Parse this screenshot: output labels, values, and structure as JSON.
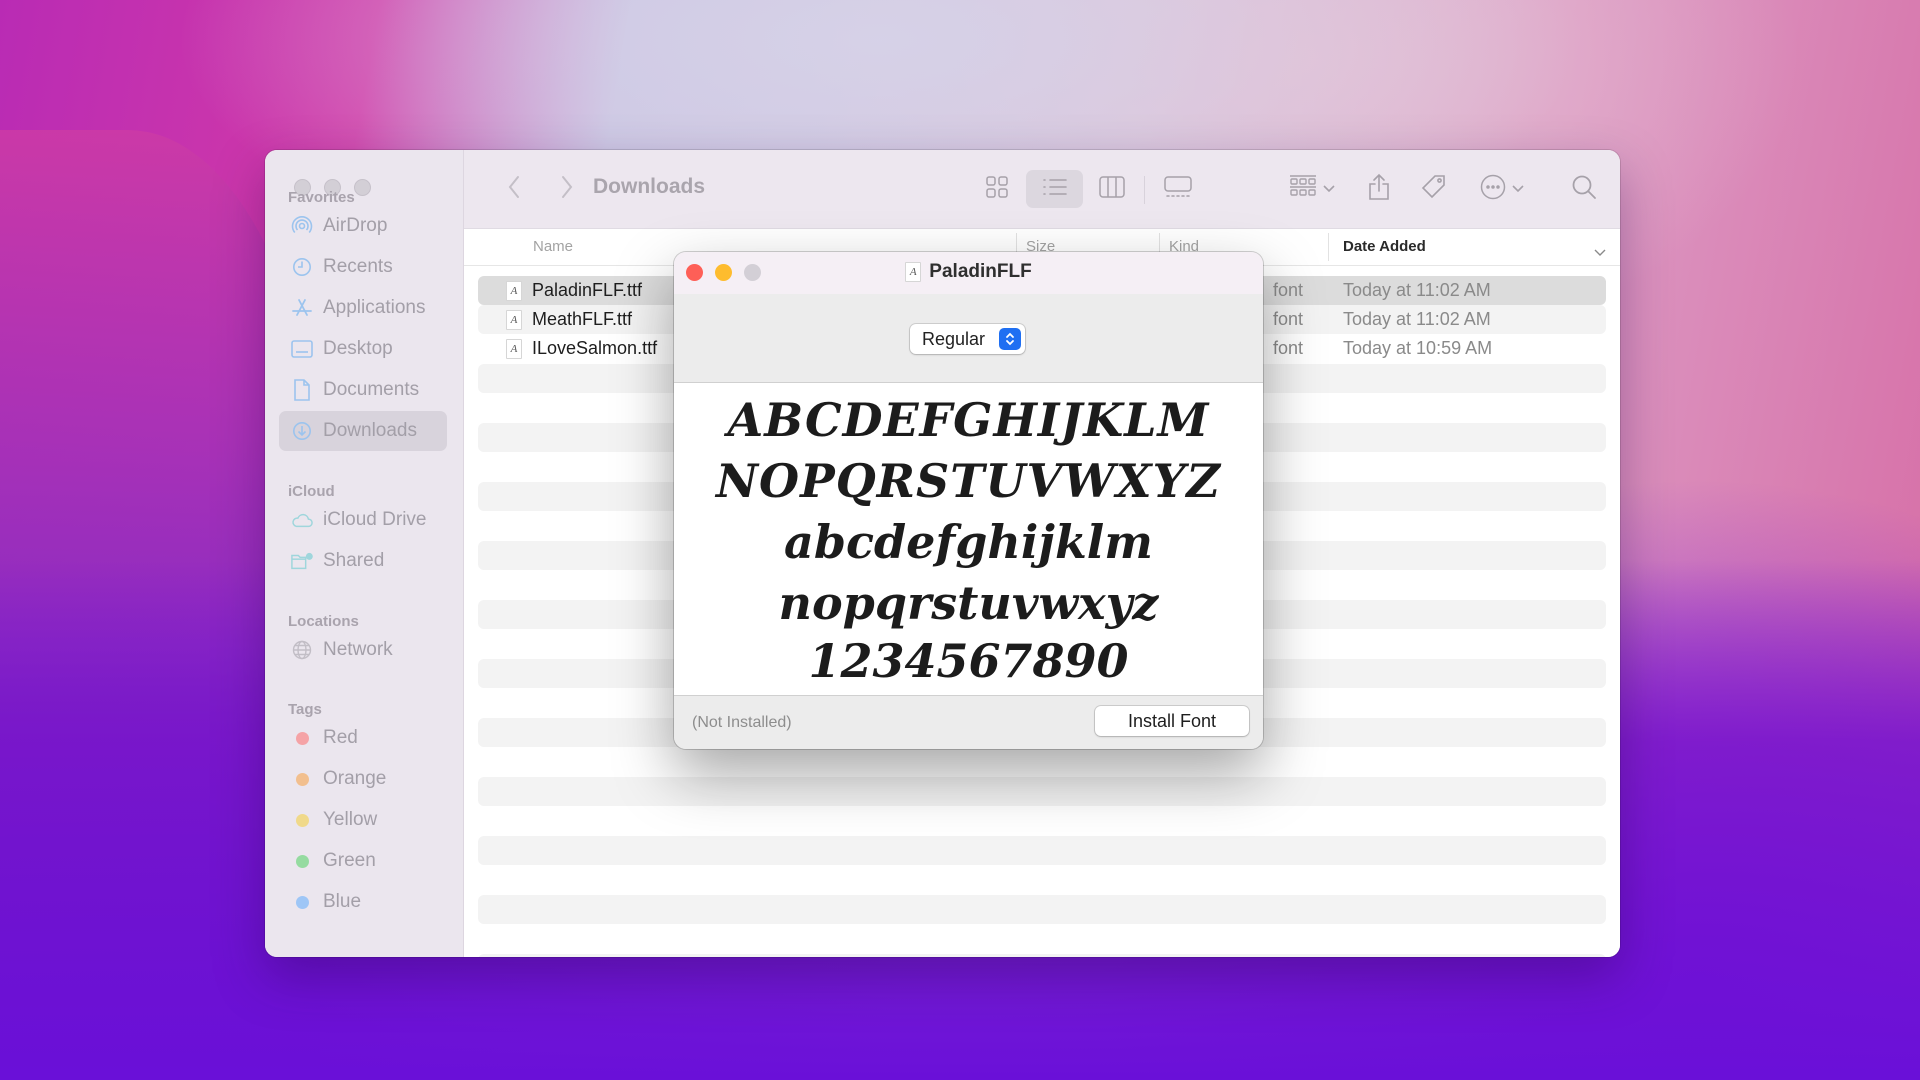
{
  "finder": {
    "title": "Downloads",
    "sidebar": {
      "sections": [
        {
          "title": "Favorites",
          "items": [
            {
              "label": "AirDrop",
              "icon": "airdrop-icon"
            },
            {
              "label": "Recents",
              "icon": "clock-icon"
            },
            {
              "label": "Applications",
              "icon": "applications-icon"
            },
            {
              "label": "Desktop",
              "icon": "desktop-icon"
            },
            {
              "label": "Documents",
              "icon": "document-icon"
            },
            {
              "label": "Downloads",
              "icon": "download-icon",
              "active": true
            }
          ]
        },
        {
          "title": "iCloud",
          "items": [
            {
              "label": "iCloud Drive",
              "icon": "cloud-icon"
            },
            {
              "label": "Shared",
              "icon": "shared-folder-icon"
            }
          ]
        },
        {
          "title": "Locations",
          "items": [
            {
              "label": "Network",
              "icon": "globe-icon"
            }
          ]
        },
        {
          "title": "Tags",
          "items": [
            {
              "label": "Red",
              "color": "#f5a3a6"
            },
            {
              "label": "Orange",
              "color": "#f2bf8e"
            },
            {
              "label": "Yellow",
              "color": "#f0d98a"
            },
            {
              "label": "Green",
              "color": "#95dba0"
            },
            {
              "label": "Blue",
              "color": "#9ec6f6"
            }
          ]
        }
      ]
    },
    "toolbar": {
      "back": "chevron-left-icon",
      "forward": "chevron-right-icon",
      "view_modes": [
        "icon-view",
        "list-view",
        "column-view",
        "gallery-view"
      ],
      "selected_view": "list-view"
    },
    "columns": {
      "name": "Name",
      "size": "Size",
      "kind": "Kind",
      "date_added": "Date Added"
    },
    "files": [
      {
        "name": "PaladinFLF.ttf",
        "kind": "font",
        "date_added": "Today at 11:02 AM",
        "selected": true
      },
      {
        "name": "MeathFLF.ttf",
        "kind": "font",
        "date_added": "Today at 11:02 AM"
      },
      {
        "name": "ILoveSalmon.ttf",
        "kind": "font",
        "date_added": "Today at 10:59 AM"
      }
    ]
  },
  "dialog": {
    "title": "PaladinFLF",
    "style_selected": "Regular",
    "preview_lines": [
      "ABCDEFGHIJKLM",
      "NOPQRSTUVWXYZ",
      "abcdefghijklm",
      "nopqrstuvwxyz",
      "1234567890"
    ],
    "status": "(Not Installed)",
    "install_button": "Install Font",
    "colors": {
      "close": "#fe5f57",
      "minimize": "#febc2e",
      "zoom_inactive": "#d3cfd6",
      "accent": "#1f6ff2"
    }
  }
}
